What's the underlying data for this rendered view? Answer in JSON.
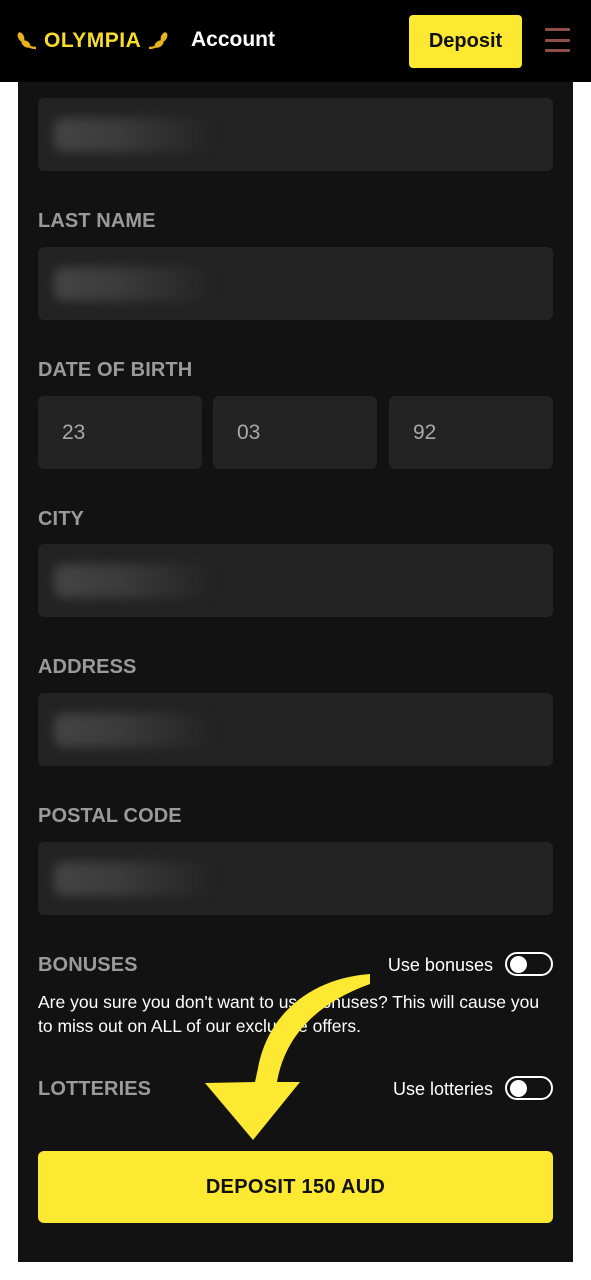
{
  "header": {
    "logo_text": "OLYMPIA",
    "title": "Account",
    "deposit_label": "Deposit",
    "menu_icon": "hamburger-menu-icon",
    "brand_color": "#fde832"
  },
  "form": {
    "last_name_label": "LAST NAME",
    "dob_label": "DATE OF BIRTH",
    "dob_day": "23",
    "dob_month": "03",
    "dob_year": "92",
    "city_label": "CITY",
    "address_label": "ADDRESS",
    "postal_code_label": "POSTAL CODE"
  },
  "bonuses": {
    "label": "BONUSES",
    "toggle_label": "Use bonuses",
    "toggle_on": false,
    "message": "Are you sure you don't want to use bonuses? This will cause you to miss out on ALL of our exclusive offers."
  },
  "lotteries": {
    "label": "LOTTERIES",
    "toggle_label": "Use lotteries",
    "toggle_on": false
  },
  "submit": {
    "label": "DEPOSIT 150 AUD"
  }
}
